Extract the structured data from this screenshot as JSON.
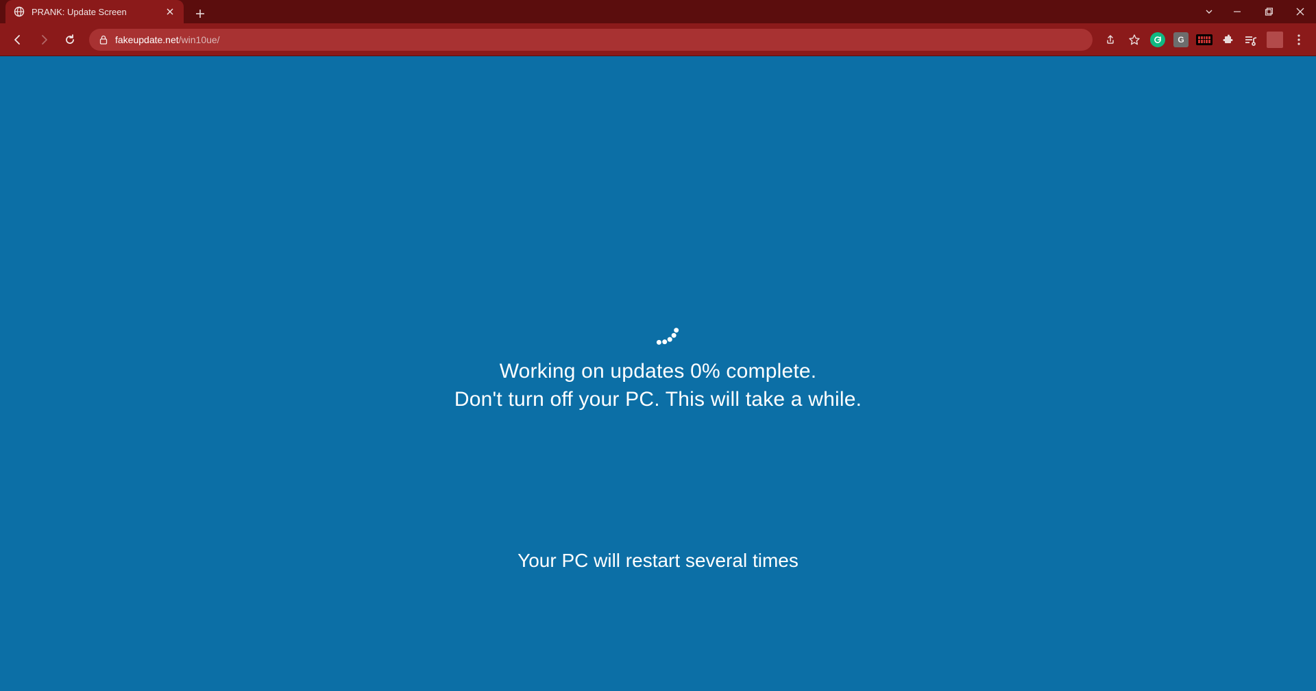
{
  "browser": {
    "tab": {
      "title": "PRANK: Update Screen"
    },
    "url": {
      "host": "fakeupdate.net",
      "path": "/win10ue/"
    },
    "extensions": {
      "g1": "G",
      "g2": "G"
    }
  },
  "page": {
    "line1_prefix": "Working on updates  ",
    "percent": "0%",
    "line1_suffix": " complete.",
    "line2": "Don't turn off your PC. This will take a while.",
    "footer": "Your PC will restart several times"
  }
}
